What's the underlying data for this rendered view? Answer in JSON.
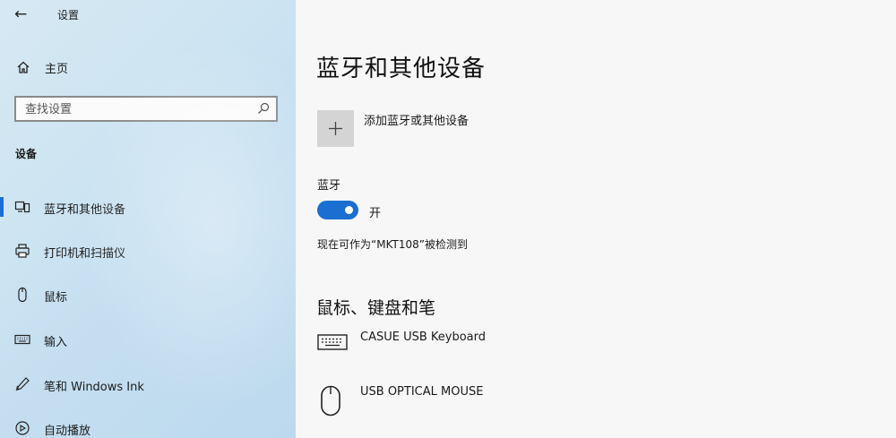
{
  "window": {
    "title": "设置"
  },
  "sidebar": {
    "home_label": "主页",
    "search_placeholder": "查找设置",
    "section_title": "设备",
    "items": [
      {
        "label": "蓝牙和其他设备",
        "icon": "bluetooth-devices-icon",
        "active": true
      },
      {
        "label": "打印机和扫描仪",
        "icon": "printer-icon"
      },
      {
        "label": "鼠标",
        "icon": "mouse-icon"
      },
      {
        "label": "输入",
        "icon": "keyboard-icon"
      },
      {
        "label": "笔和 Windows Ink",
        "icon": "pen-icon"
      },
      {
        "label": "自动播放",
        "icon": "autoplay-icon"
      }
    ]
  },
  "main": {
    "title": "蓝牙和其他设备",
    "add_device_label": "添加蓝牙或其他设备",
    "bluetooth": {
      "label": "蓝牙",
      "toggle_on": true,
      "state_label": "开",
      "discoverable_text": "现在可作为“MKT108”被检测到"
    },
    "mouse_keyboard_pen": {
      "title": "鼠标、键盘和笔",
      "devices": [
        {
          "name": "CASUE USB Keyboard",
          "icon": "keyboard-icon"
        },
        {
          "name": "USB OPTICAL MOUSE",
          "icon": "mouse-icon"
        }
      ]
    }
  },
  "colors": {
    "accent": "#1a6fd0",
    "sidebar_bg": "#cfe5f2",
    "main_bg": "#f7f7f7",
    "tile_bg": "#d4d4d4"
  }
}
